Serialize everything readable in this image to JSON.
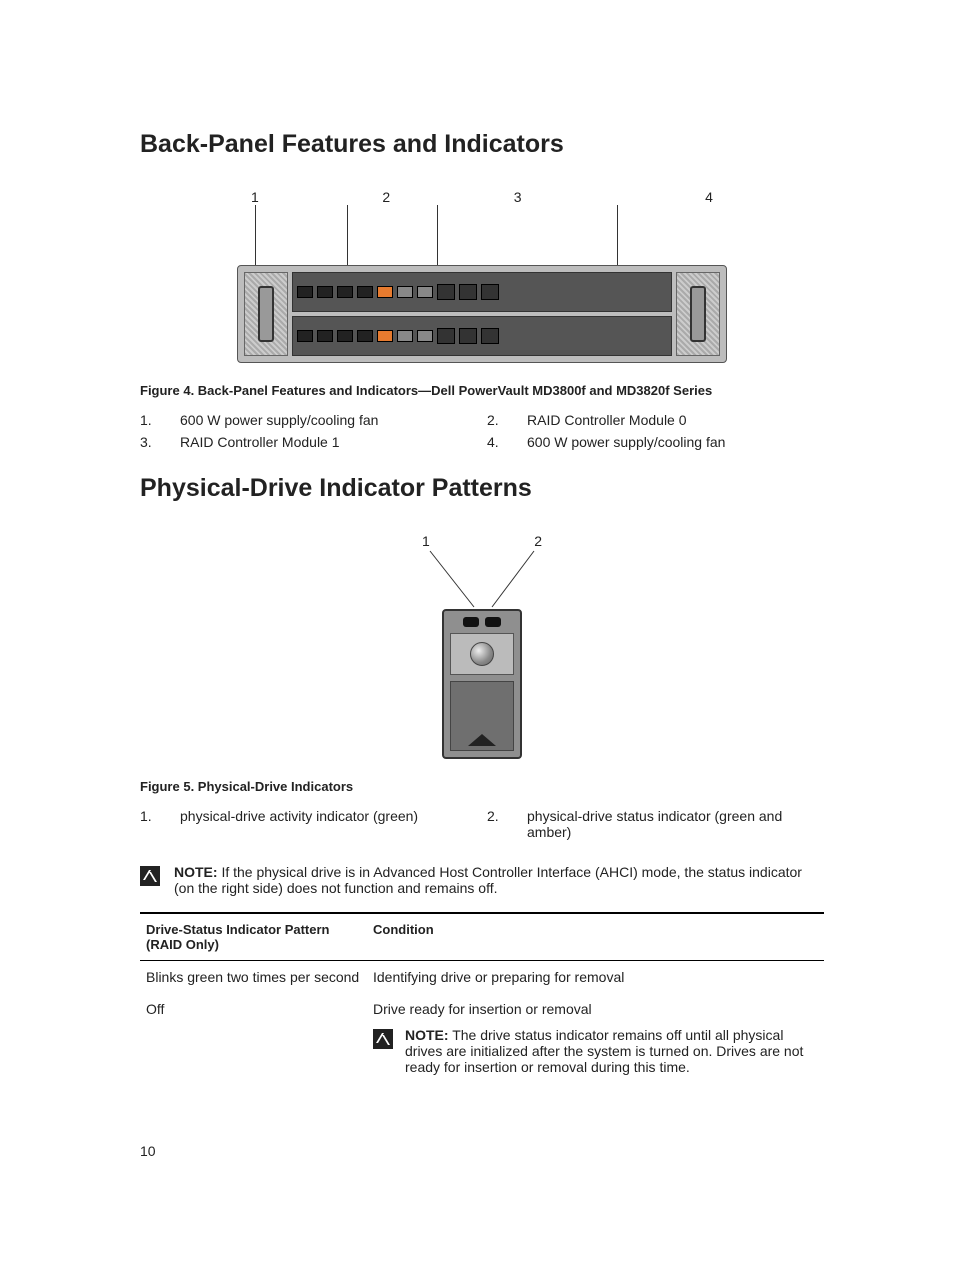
{
  "section1": {
    "heading": "Back-Panel Features and Indicators",
    "figure": {
      "numbers": [
        "1",
        "2",
        "3",
        "4"
      ],
      "caption": "Figure 4. Back-Panel Features and Indicators—Dell PowerVault MD3800f and MD3820f Series"
    },
    "callouts": [
      {
        "n": "1.",
        "t": "600 W power supply/cooling fan"
      },
      {
        "n": "2.",
        "t": "RAID Controller Module 0"
      },
      {
        "n": "3.",
        "t": "RAID Controller Module 1"
      },
      {
        "n": "4.",
        "t": "600 W power supply/cooling fan"
      }
    ]
  },
  "section2": {
    "heading": "Physical-Drive Indicator Patterns",
    "figure": {
      "numbers": [
        "1",
        "2"
      ],
      "caption": "Figure 5. Physical-Drive Indicators"
    },
    "callouts": [
      {
        "n": "1.",
        "t": "physical-drive activity indicator (green)"
      },
      {
        "n": "2.",
        "t": "physical-drive status indicator (green and amber)"
      }
    ],
    "note": {
      "label": "NOTE:",
      "text": " If the physical drive is in Advanced Host Controller Interface (AHCI) mode, the status indicator (on the right side) does not function and remains off."
    },
    "table": {
      "head": {
        "c1": "Drive-Status Indicator Pattern (RAID Only)",
        "c2": "Condition"
      },
      "rows": [
        {
          "pattern": "Blinks green two times per second",
          "condition": "Identifying drive or preparing for removal",
          "note": null
        },
        {
          "pattern": "Off",
          "condition": "Drive ready for insertion or removal",
          "note": {
            "label": "NOTE:",
            "text": " The drive status indicator remains off until all physical drives are initialized after the system is turned on. Drives are not ready for insertion or removal during this time."
          }
        }
      ]
    }
  },
  "pageNumber": "10"
}
